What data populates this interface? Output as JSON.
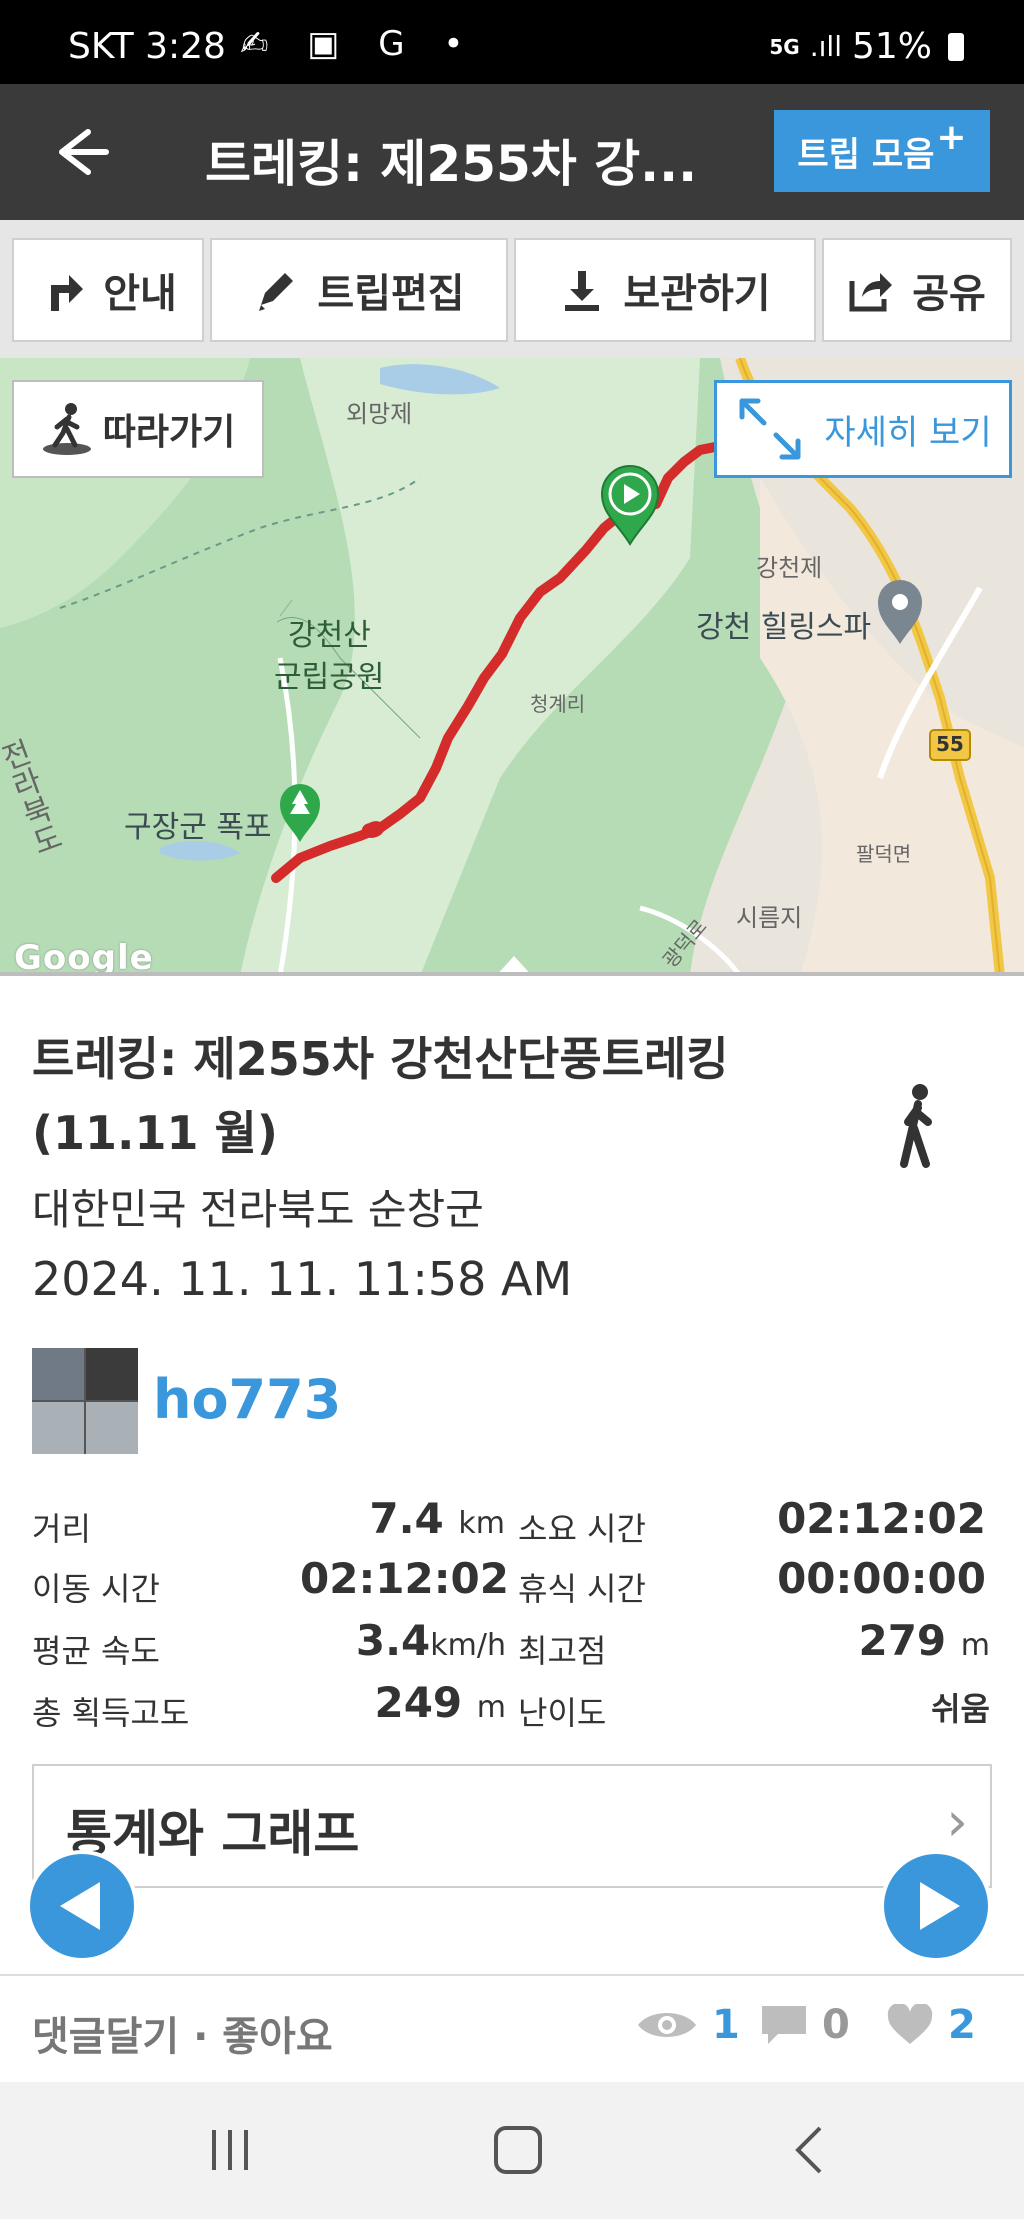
{
  "status_bar": {
    "carrier_time": "SKT 3:28",
    "notification_icons": "✍ ▣ G •",
    "network": "5G",
    "signal": ".ıll",
    "battery": "51%"
  },
  "app_bar": {
    "title": "트레킹: 제255차 강...",
    "trip_collection_label": "트립 모음",
    "trip_collection_plus": "+"
  },
  "actions": {
    "guide": "안내",
    "edit": "트립편집",
    "save": "보관하기",
    "share": "공유"
  },
  "map": {
    "follow_label": "따라가기",
    "detail_label": "자세히 보기",
    "labels": {
      "oemangje": "외망제",
      "gangcheonje": "강천제",
      "gangcheon_spa": "강천 힐링스파",
      "park_line1": "강천산",
      "park_line2": "군립공원",
      "cheonggyeri": "청계리",
      "road_55": "55",
      "jeolla": "전라북도",
      "gujang_falls": "구장군 폭포",
      "paldeok": "팔덕면",
      "sireumji": "시름지",
      "gwangdeok": "광덕로"
    },
    "attribution": "Google"
  },
  "trip": {
    "name": "트레킹: 제255차 강천산단풍트레킹(11.11 월)",
    "location": "대한민국 전라북도 순창군",
    "datetime": "2024. 11. 11. 11:58 AM",
    "username": "ho773"
  },
  "stats": {
    "distance_label": "거리",
    "distance_value": "7.4",
    "distance_unit": "km",
    "duration_label": "소요 시간",
    "duration_value": "02:12:02",
    "moving_label": "이동 시간",
    "moving_value": "02:12:02",
    "rest_label": "휴식 시간",
    "rest_value": "00:00:00",
    "avg_speed_label": "평균 속도",
    "avg_speed_value": "3.4",
    "avg_speed_unit": "km/h",
    "max_alt_label": "최고점",
    "max_alt_value": "279",
    "max_alt_unit": "m",
    "gain_label": "총 획득고도",
    "gain_value": "249",
    "gain_unit": "m",
    "difficulty_label": "난이도",
    "difficulty_value": "쉬움"
  },
  "graph_section": {
    "title": "통계와 그래프",
    "chevron": "›"
  },
  "comment_bar": {
    "label": "댓글달기 · 좋아요",
    "views": "1",
    "comments": "0",
    "likes": "2"
  },
  "colors": {
    "accent": "#3a97db",
    "app_bar": "#3a3a3a",
    "route": "#d42b2b"
  }
}
